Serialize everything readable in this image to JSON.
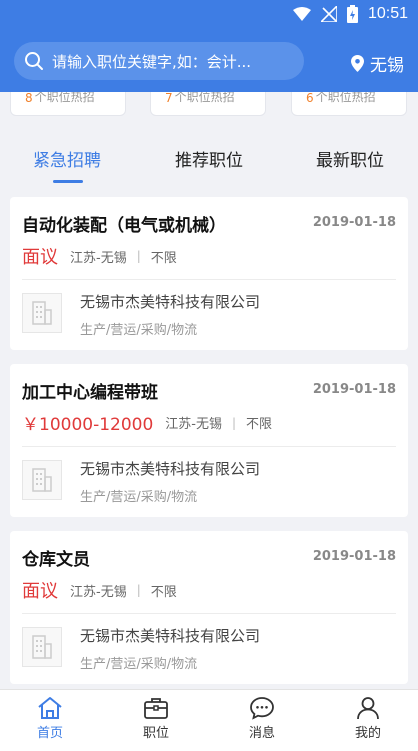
{
  "status": {
    "time": "10:51"
  },
  "search": {
    "placeholder": "请输入职位关键字,如：会计..."
  },
  "location": {
    "city": "无锡"
  },
  "hot_cards": [
    {
      "num": "8",
      "text": "个职位热招"
    },
    {
      "num": "7",
      "text": "个职位热招"
    },
    {
      "num": "6",
      "text": "个职位热招"
    }
  ],
  "tabs": [
    {
      "label": "紧急招聘",
      "active": true
    },
    {
      "label": "推荐职位",
      "active": false
    },
    {
      "label": "最新职位",
      "active": false
    }
  ],
  "jobs": [
    {
      "title": "自动化装配（电气或机械）",
      "date": "2019-01-18",
      "salary": "面议",
      "location": "江苏-无锡",
      "separator": "|",
      "limit": "不限",
      "company": "无锡市杰美特科技有限公司",
      "industry": "生产/营运/采购/物流"
    },
    {
      "title": "加工中心编程带班",
      "date": "2019-01-18",
      "salary": "￥10000-12000",
      "location": "江苏-无锡",
      "separator": "|",
      "limit": "不限",
      "company": "无锡市杰美特科技有限公司",
      "industry": "生产/营运/采购/物流"
    },
    {
      "title": "仓库文员",
      "date": "2019-01-18",
      "salary": "面议",
      "location": "江苏-无锡",
      "separator": "|",
      "limit": "不限",
      "company": "无锡市杰美特科技有限公司",
      "industry": "生产/营运/采购/物流"
    }
  ],
  "nav": [
    {
      "label": "首页",
      "icon": "home-icon",
      "active": true
    },
    {
      "label": "职位",
      "icon": "briefcase-icon",
      "active": false
    },
    {
      "label": "消息",
      "icon": "message-icon",
      "active": false
    },
    {
      "label": "我的",
      "icon": "user-icon",
      "active": false
    }
  ],
  "colors": {
    "primary": "#3e7de4",
    "salary": "#e03a3a",
    "hot_number": "#f0822d"
  }
}
